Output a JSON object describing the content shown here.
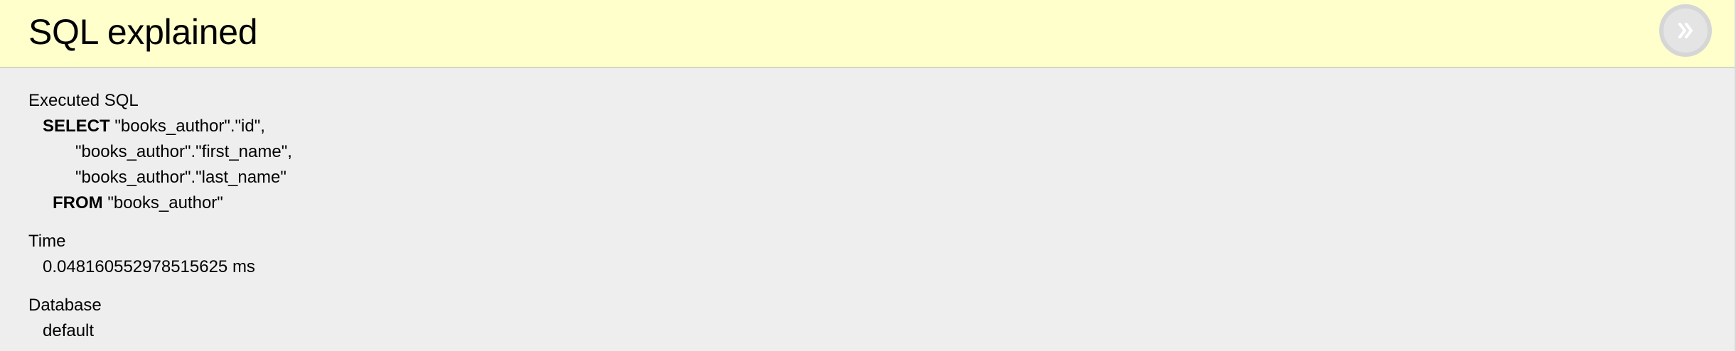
{
  "header": {
    "title": "SQL explained"
  },
  "close_button": {
    "icon": "double-chevron-right-icon",
    "color": "#ffffff",
    "ring_color": "#d6d6d6"
  },
  "colors": {
    "header_bg": "#ffffcc",
    "body_bg": "#eeeeee"
  },
  "sections": {
    "executed_sql": {
      "label": "Executed SQL",
      "select_kw": "SELECT",
      "col1": "\"books_author\".\"id\",",
      "col2": "\"books_author\".\"first_name\",",
      "col3": "\"books_author\".\"last_name\"",
      "from_kw": "FROM",
      "table": "\"books_author\""
    },
    "time": {
      "label": "Time",
      "value": "0.04816055297851562​5 ms"
    },
    "database": {
      "label": "Database",
      "value": "default"
    }
  }
}
